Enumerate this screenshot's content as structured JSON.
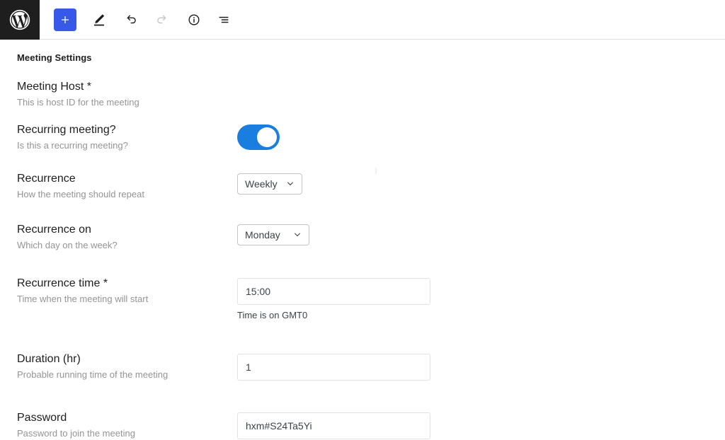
{
  "toolbar": {
    "logo_name": "WordPress",
    "buttons": [
      {
        "name": "add-block-button",
        "label": "Add block",
        "icon": "plus-icon",
        "state": "primary"
      },
      {
        "name": "edit-tool-button",
        "label": "Edit",
        "icon": "pencil-icon",
        "state": "active"
      },
      {
        "name": "undo-button",
        "label": "Undo",
        "icon": "undo-icon",
        "state": "enabled"
      },
      {
        "name": "redo-button",
        "label": "Redo",
        "icon": "redo-icon",
        "state": "disabled"
      },
      {
        "name": "details-button",
        "label": "Details",
        "icon": "info-icon",
        "state": "enabled"
      },
      {
        "name": "list-view-button",
        "label": "List view",
        "icon": "list-view-icon",
        "state": "enabled"
      }
    ]
  },
  "panel": {
    "title": "Meeting Settings"
  },
  "fields": {
    "host": {
      "label": "Meeting Host *",
      "help": "This is host ID for the meeting",
      "value": ""
    },
    "recurring": {
      "label": "Recurring meeting?",
      "help": "Is this a recurring meeting?",
      "value": "on"
    },
    "recurrence": {
      "label": "Recurrence",
      "help": "How the meeting should repeat",
      "value": "Weekly",
      "options": [
        "Weekly"
      ]
    },
    "recurrence_on": {
      "label": "Recurrence on",
      "help": "Which day on the week?",
      "value": "Monday",
      "options": [
        "Monday"
      ]
    },
    "recurrence_time": {
      "label": "Recurrence time *",
      "help": "Time when the meeting will start",
      "value": "15:00",
      "note": "Time is on GMT0"
    },
    "duration": {
      "label": "Duration (hr)",
      "help": "Probable running time of the meeting",
      "value": "1"
    },
    "password": {
      "label": "Password",
      "help": "Password to join the meeting",
      "value": "hxm#S24Ta5Yi"
    }
  },
  "colors": {
    "accent_blue": "#3858e9",
    "toggle_blue": "#1a7ee0",
    "logo_bg": "#1e1e1e",
    "help_text": "#949494"
  }
}
